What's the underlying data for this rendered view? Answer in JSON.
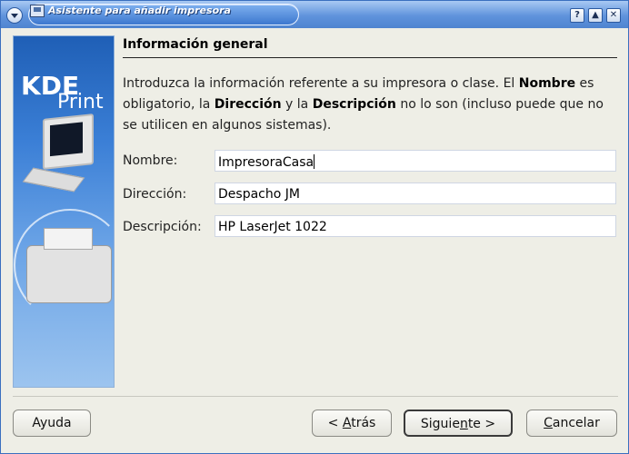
{
  "window": {
    "title": "Asistente para añadir impresora"
  },
  "titlebar_buttons": {
    "help": "?",
    "shade": "▲",
    "close": "✕"
  },
  "banner": {
    "kde": "KDE",
    "print": "Print"
  },
  "page": {
    "heading": "Información general",
    "description": {
      "p1": "Introduzca la información referente a su impresora o clase. El ",
      "b1": "Nombre",
      "p2": " es obligatorio, la ",
      "b2": "Dirección",
      "p3": " y la ",
      "b3": "Descripción",
      "p4": " no lo son (incluso puede que no se utilicen en algunos sistemas)."
    },
    "fields": {
      "name_label": "Nombre:",
      "name_value": "ImpresoraCasa",
      "location_label": "Dirección:",
      "location_value": "Despacho JM",
      "description_label": "Descripción:",
      "description_value": "HP LaserJet 1022"
    }
  },
  "buttons": {
    "help": "Ayuda",
    "back_prefix": "< ",
    "back_mnemonic": "A",
    "back_rest": "trás",
    "next_prefix": "Siguie",
    "next_mnemonic": "n",
    "next_rest": "te >",
    "cancel_mnemonic": "C",
    "cancel_rest": "ancelar"
  }
}
